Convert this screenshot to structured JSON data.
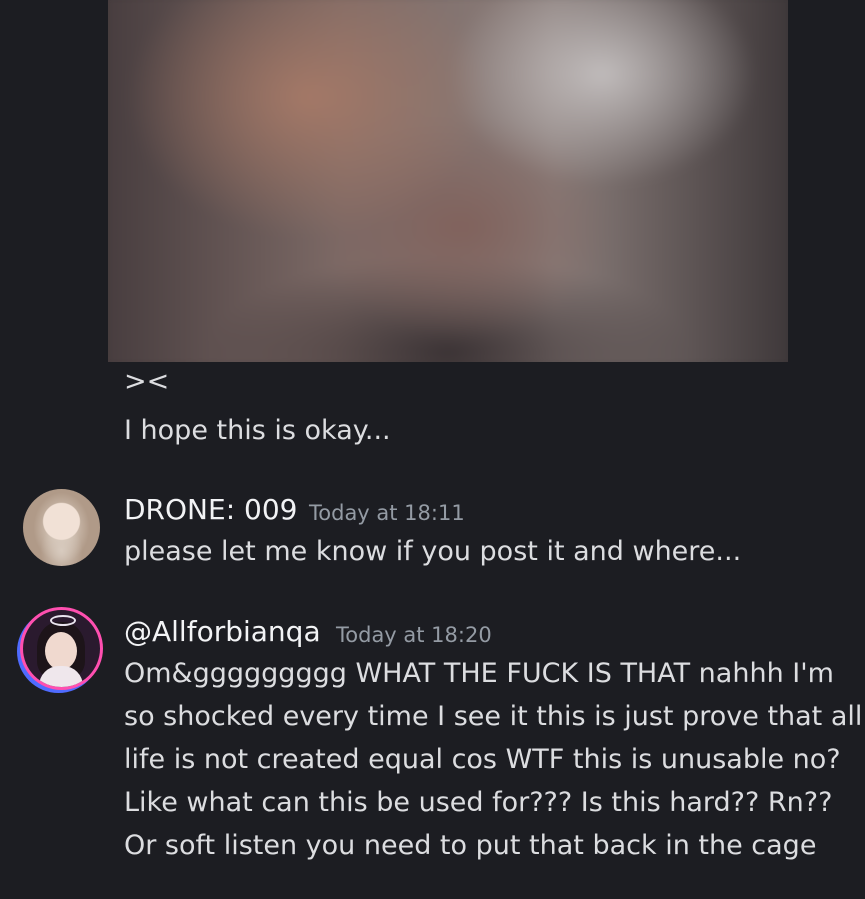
{
  "messages": {
    "first": {
      "attachment": "blurred-image",
      "emote": "><",
      "text": "I hope this is okay..."
    },
    "drone": {
      "username": "DRONE: 009",
      "timestamp": "Today at 18:11",
      "text": "please let me know if you post it and where..."
    },
    "allfor": {
      "username": "@Allforbianqa",
      "timestamp": "Today at 18:20",
      "lines": [
        "Om&ggggggggg WHAT THE FUCK IS THAT nahhh I'm",
        "so shocked every time I see it this is just prove that all",
        "life is not created equal cos WTF this is unusable no?",
        "Like what can this be used for??? Is this hard?? Rn??",
        "Or soft listen you need to put that back in the cage"
      ]
    }
  }
}
